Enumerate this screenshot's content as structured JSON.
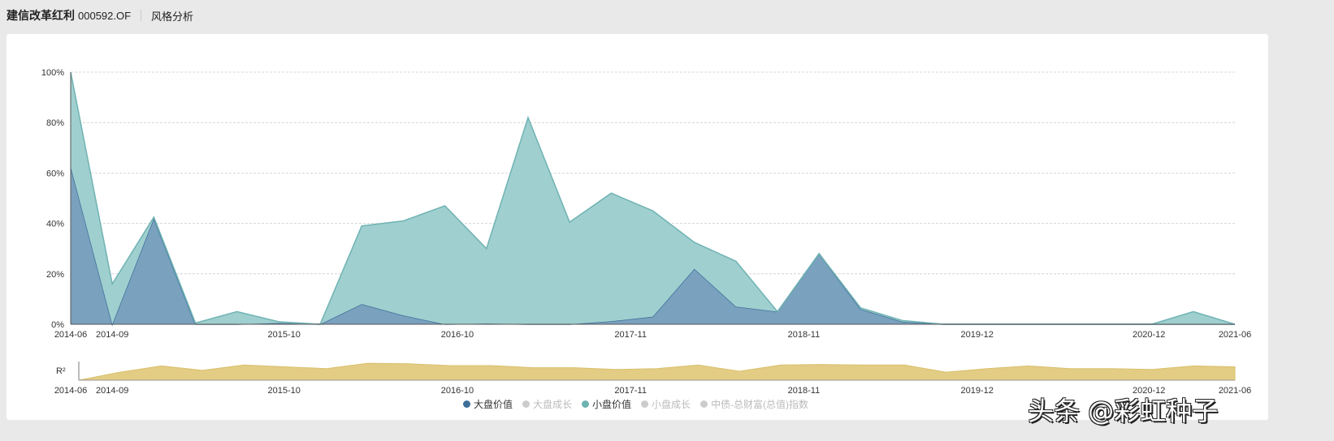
{
  "header": {
    "fund_name": "建信改革红利",
    "fund_code": "000592.OF",
    "section": "风格分析"
  },
  "chart_data": [
    {
      "type": "area",
      "stacked": true,
      "title": "",
      "ylim": [
        0,
        100
      ],
      "y_ticks": [
        "0%",
        "20%",
        "40%",
        "60%",
        "80%",
        "100%"
      ],
      "y_tick_values": [
        0,
        20,
        40,
        60,
        80,
        100
      ],
      "x_months_range": [
        0,
        84
      ],
      "x_ticks": [
        {
          "label": "2014-06",
          "month": 0
        },
        {
          "label": "2014-09",
          "month": 3
        },
        {
          "label": "2015-10",
          "month": 15.4
        },
        {
          "label": "2016-10",
          "month": 27.9
        },
        {
          "label": "2017-11",
          "month": 40.4
        },
        {
          "label": "2018-11",
          "month": 52.9
        },
        {
          "label": "2019-12",
          "month": 65.4
        },
        {
          "label": "2020-12",
          "month": 77.8
        },
        {
          "label": "2021-06",
          "month": 84
        }
      ],
      "grid": true,
      "series": [
        {
          "name": "大盘价值",
          "color": "#3d6f99",
          "values": [
            62.5,
            0,
            42,
            0,
            0,
            0.5,
            0,
            8,
            3.5,
            0,
            0.3,
            0,
            0,
            1.2,
            3,
            22,
            7,
            5,
            28,
            6,
            1,
            0,
            0,
            0,
            0,
            0,
            0,
            0,
            0
          ]
        },
        {
          "name": "小盘价值",
          "color": "#6fb3b3",
          "values": [
            37.5,
            16,
            0.5,
            0.5,
            5,
            0.5,
            0,
            31,
            37.5,
            47,
            29.7,
            82,
            40.5,
            50.8,
            42,
            10.5,
            18,
            0,
            0,
            0.5,
            0.5,
            0,
            0,
            0,
            0,
            0,
            0,
            5,
            0
          ]
        }
      ]
    },
    {
      "type": "area",
      "ylabel": "R²",
      "ylim": [
        0,
        1
      ],
      "color": "#e3cd85",
      "values": [
        0,
        0.45,
        0.8,
        0.55,
        0.85,
        0.75,
        0.65,
        0.95,
        0.92,
        0.82,
        0.82,
        0.7,
        0.7,
        0.6,
        0.65,
        0.85,
        0.5,
        0.85,
        0.88,
        0.85,
        0.85,
        0.45,
        0.65,
        0.8,
        0.65,
        0.65,
        0.6,
        0.8,
        0.75
      ],
      "x_ticks": [
        {
          "label": "2014-06",
          "month": 0
        },
        {
          "label": "2014-09",
          "month": 3
        },
        {
          "label": "2015-10",
          "month": 15.4
        },
        {
          "label": "2016-10",
          "month": 27.9
        },
        {
          "label": "2017-11",
          "month": 40.4
        },
        {
          "label": "2018-11",
          "month": 52.9
        },
        {
          "label": "2019-12",
          "month": 65.4
        },
        {
          "label": "2020-12",
          "month": 77.8
        },
        {
          "label": "2021-06",
          "month": 84
        }
      ]
    }
  ],
  "legend": [
    {
      "label": "大盘价值",
      "color": "#3d6f99",
      "active": true
    },
    {
      "label": "大盘成长",
      "color": "#cccccc",
      "active": false
    },
    {
      "label": "小盘价值",
      "color": "#6fb3b3",
      "active": true
    },
    {
      "label": "小盘成长",
      "color": "#cccccc",
      "active": false
    },
    {
      "label": "中债-总财富(总值)指数",
      "color": "#cccccc",
      "active": false
    }
  ],
  "watermark": "头条 @彩虹种子"
}
